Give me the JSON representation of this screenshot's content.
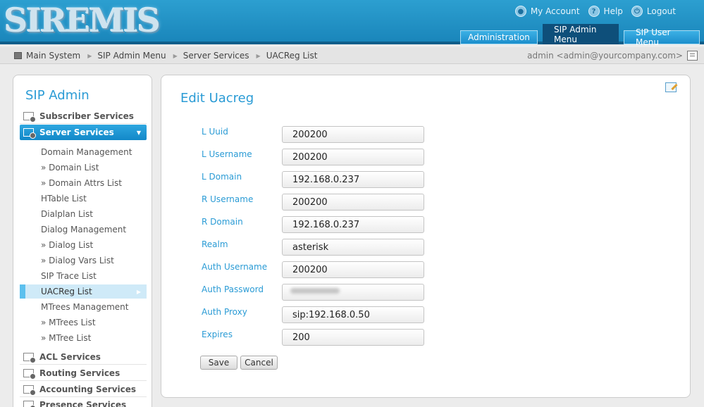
{
  "header": {
    "logo_text": "SIREMIS",
    "links": [
      {
        "label": "My Account",
        "icon": "user-icon"
      },
      {
        "label": "Help",
        "icon": "help-icon"
      },
      {
        "label": "Logout",
        "icon": "power-icon"
      }
    ],
    "tabs": [
      {
        "label": "Administration",
        "active": false
      },
      {
        "label": "SIP Admin Menu",
        "active": true
      },
      {
        "label": "SIP User Menu",
        "active": false
      }
    ]
  },
  "breadcrumb": {
    "items": [
      "Main System",
      "SIP Admin Menu",
      "Server Services",
      "UACReg List"
    ],
    "user": "admin <admin@yourcompany.com>"
  },
  "sidebar": {
    "title": "SIP Admin",
    "sections_top": [
      {
        "label": "Subscriber Services",
        "active": false
      },
      {
        "label": "Server Services",
        "active": true
      }
    ],
    "items": [
      "Domain Management",
      "» Domain List",
      "» Domain Attrs List",
      "HTable List",
      "Dialplan List",
      "Dialog Management",
      "» Dialog List",
      "» Dialog Vars List",
      "SIP Trace List",
      "UACReg List",
      "MTrees Management",
      "» MTrees List",
      "» MTree List"
    ],
    "active_item": "UACReg List",
    "sections_bottom": [
      "ACL Services",
      "Routing Services",
      "Accounting Services",
      "Presence Services"
    ]
  },
  "form": {
    "title": "Edit Uacreg",
    "fields": [
      {
        "label": "L Uuid",
        "value": "200200"
      },
      {
        "label": "L Username",
        "value": "200200"
      },
      {
        "label": "L Domain",
        "value": "192.168.0.237"
      },
      {
        "label": "R Username",
        "value": "200200"
      },
      {
        "label": "R Domain",
        "value": "192.168.0.237"
      },
      {
        "label": "Realm",
        "value": "asterisk"
      },
      {
        "label": "Auth Username",
        "value": "200200"
      },
      {
        "label": "Auth Password",
        "value": ""
      },
      {
        "label": "Auth Proxy",
        "value": "sip:192.168.0.50"
      },
      {
        "label": "Expires",
        "value": "200"
      }
    ],
    "save_label": "Save",
    "cancel_label": "Cancel"
  },
  "colors": {
    "accent": "#2a9bd5",
    "header_bg": "#1a86bb",
    "active_tab": "#0e4f7a"
  }
}
